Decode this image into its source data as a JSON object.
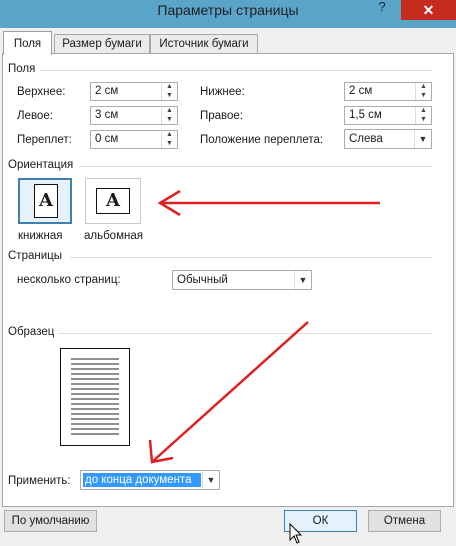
{
  "window": {
    "title": "Параметры страницы",
    "help_glyph": "?",
    "close_glyph": "✕"
  },
  "tabs": [
    {
      "label": "Поля",
      "active": true
    },
    {
      "label": "Размер бумаги",
      "active": false
    },
    {
      "label": "Источник бумаги",
      "active": false
    }
  ],
  "margins": {
    "section_title": "Поля",
    "top_label": "Верхнее:",
    "top_value": "2 см",
    "bottom_label": "Нижнее:",
    "bottom_value": "2 см",
    "left_label": "Левое:",
    "left_value": "3 см",
    "right_label": "Правое:",
    "right_value": "1,5 см",
    "gutter_label": "Переплет:",
    "gutter_value": "0 см",
    "gutter_pos_label": "Положение переплета:",
    "gutter_pos_value": "Слева"
  },
  "orientation": {
    "section_title": "Ориентация",
    "portrait_label": "книжная",
    "landscape_label": "альбомная",
    "glyph": "A",
    "selected": "portrait"
  },
  "pages": {
    "section_title": "Страницы",
    "multiple_label": "несколько страниц:",
    "multiple_value": "Обычный"
  },
  "preview": {
    "section_title": "Образец"
  },
  "apply": {
    "label": "Применить:",
    "value": "до конца документа"
  },
  "buttons": {
    "default_label": "По умолчанию",
    "ok_label": "ОК",
    "cancel_label": "Отмена"
  },
  "icons": {
    "spin_up": "▲",
    "spin_down": "▼",
    "dropdown": "▼"
  },
  "colors": {
    "titlebar": "#5aa4ca",
    "close": "#c42b1c",
    "selection": "#3399ff",
    "annotation_arrow": "#e02020"
  }
}
